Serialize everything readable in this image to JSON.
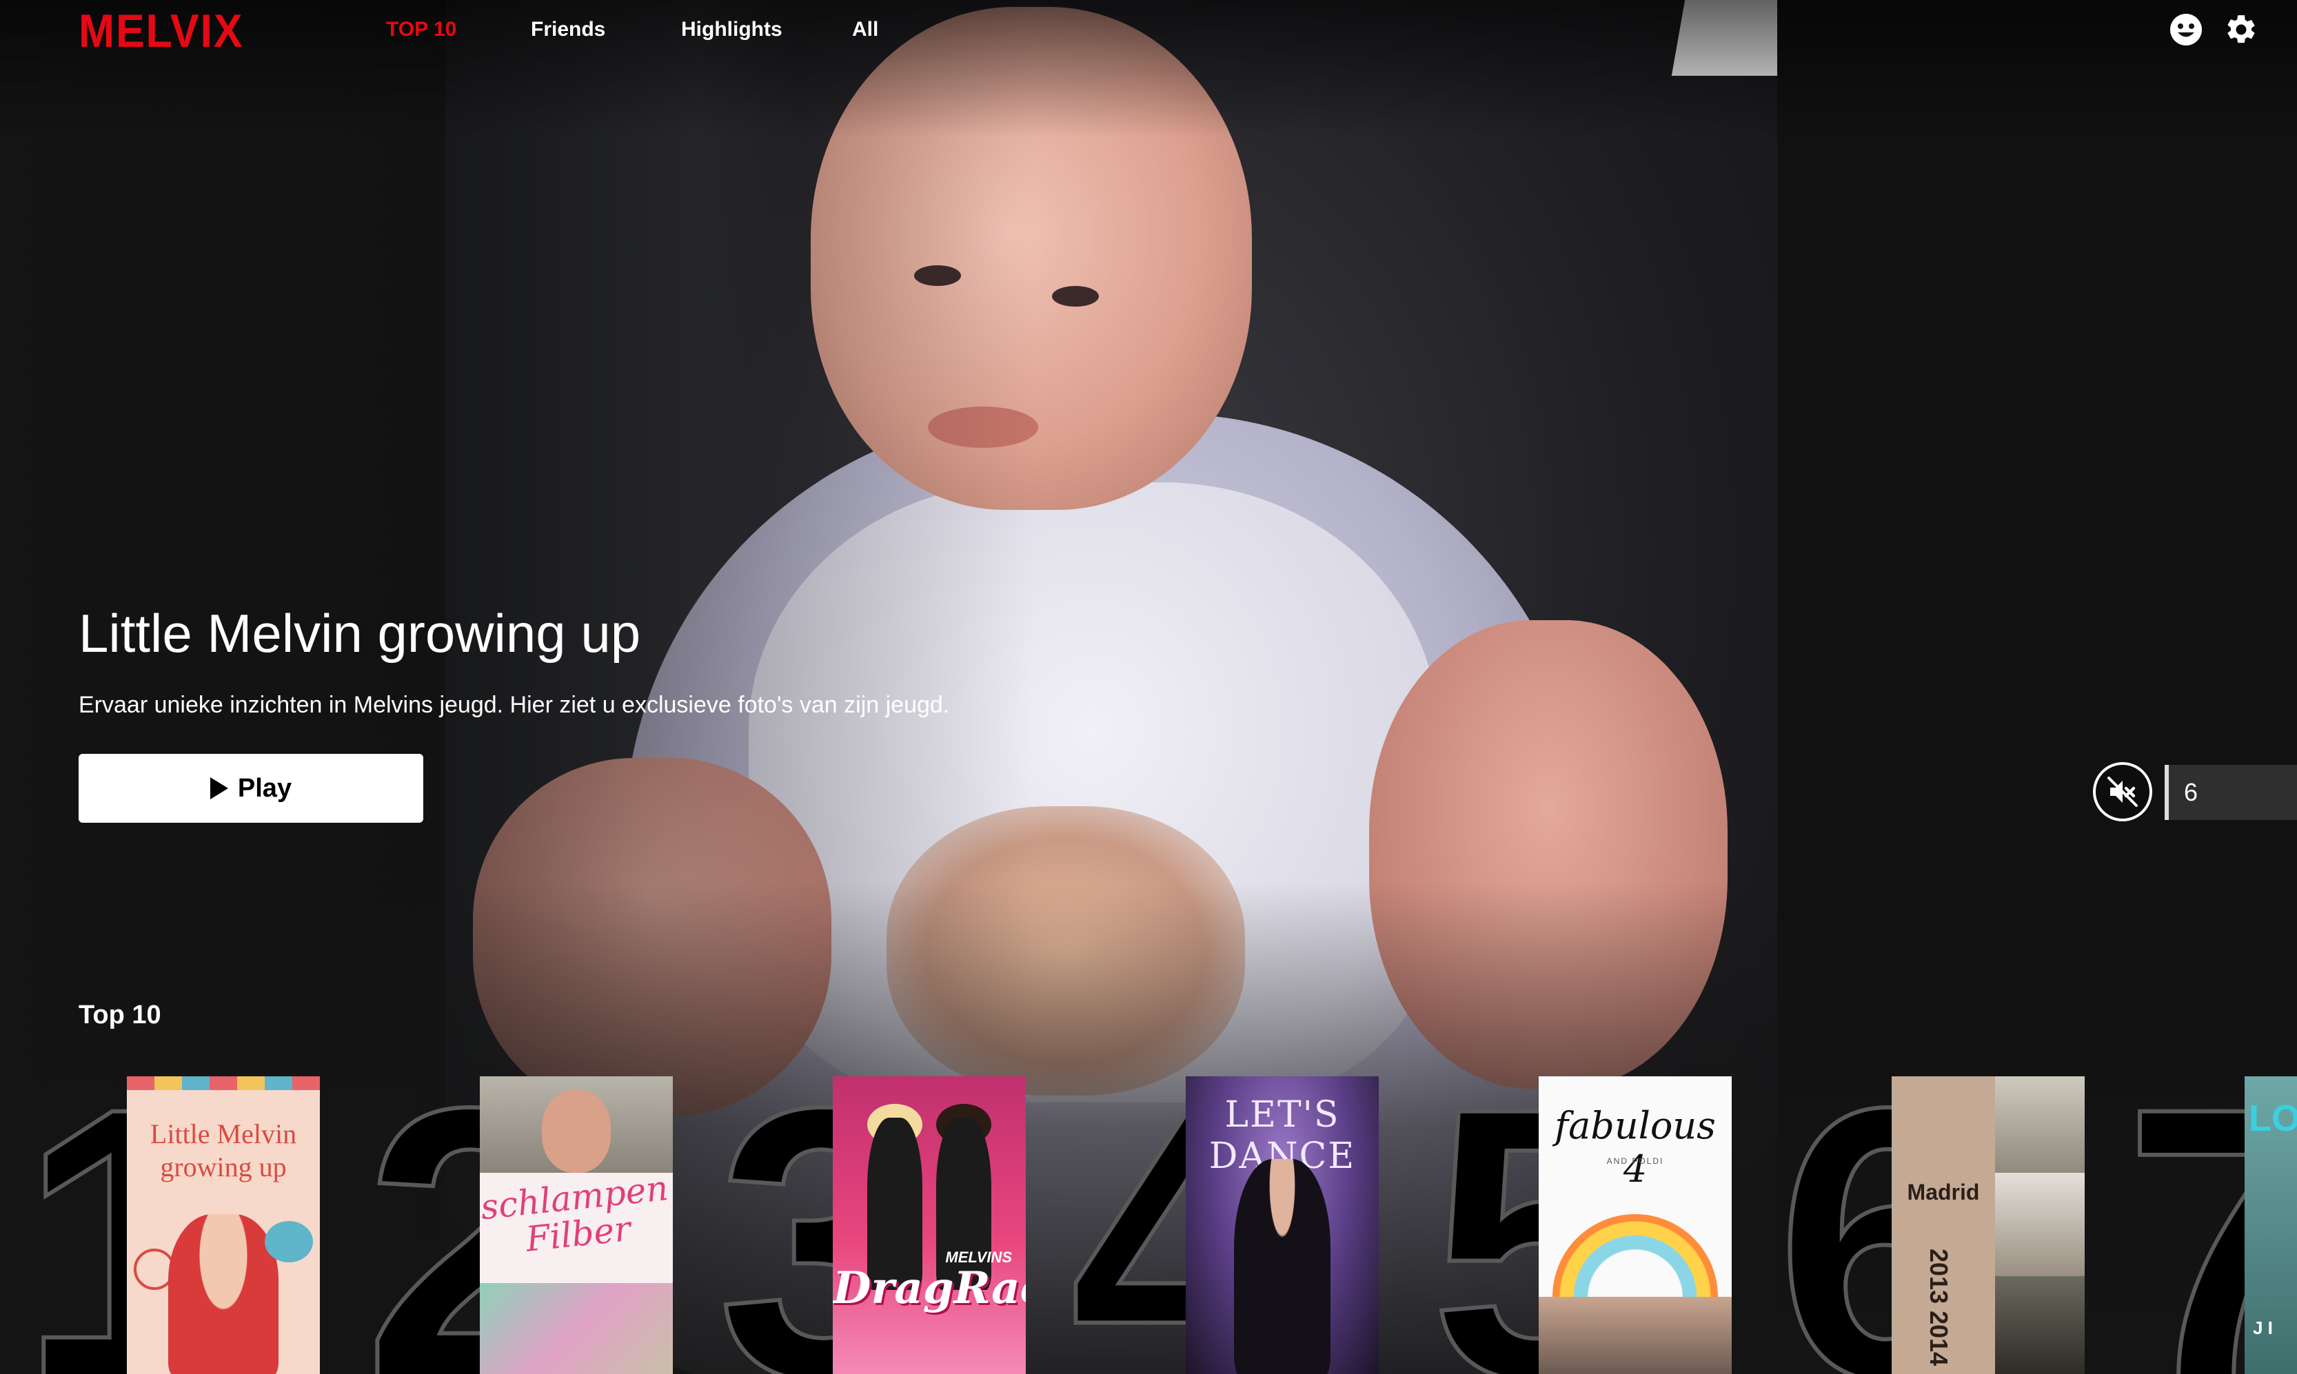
{
  "brand": {
    "logo": "MELVIX",
    "accent_color": "#e50914"
  },
  "nav": {
    "links": [
      "TOP 10",
      "Friends",
      "Highlights",
      "All"
    ],
    "active_index": 0,
    "icons": [
      "smiley-face-icon",
      "gear-icon"
    ]
  },
  "hero": {
    "title": "Little Melvin growing up",
    "description": "Ervaar unieke inzichten in Melvins jeugd. Hier ziet u exclusieve foto's van zijn jeugd.",
    "play_label": "Play",
    "mute_icon": "speaker-muted-icon",
    "age_rating": "6"
  },
  "top10": {
    "heading": "Top 10",
    "items": [
      {
        "rank": "1",
        "poster_text": "Little Melvin growing up"
      },
      {
        "rank": "2",
        "poster_text": "schlampen Filber"
      },
      {
        "rank": "3",
        "poster_text": "DragRace",
        "poster_subtext": "MELVINS"
      },
      {
        "rank": "4",
        "poster_text": "LET'S DANCE"
      },
      {
        "rank": "5",
        "poster_text": "fabulous 4",
        "poster_subtext": "AND POLDI"
      },
      {
        "rank": "6",
        "poster_text": "Madrid",
        "poster_subtext": "2013 2014"
      },
      {
        "rank": "7",
        "poster_text": "LO",
        "poster_subtext": "J I"
      }
    ]
  }
}
